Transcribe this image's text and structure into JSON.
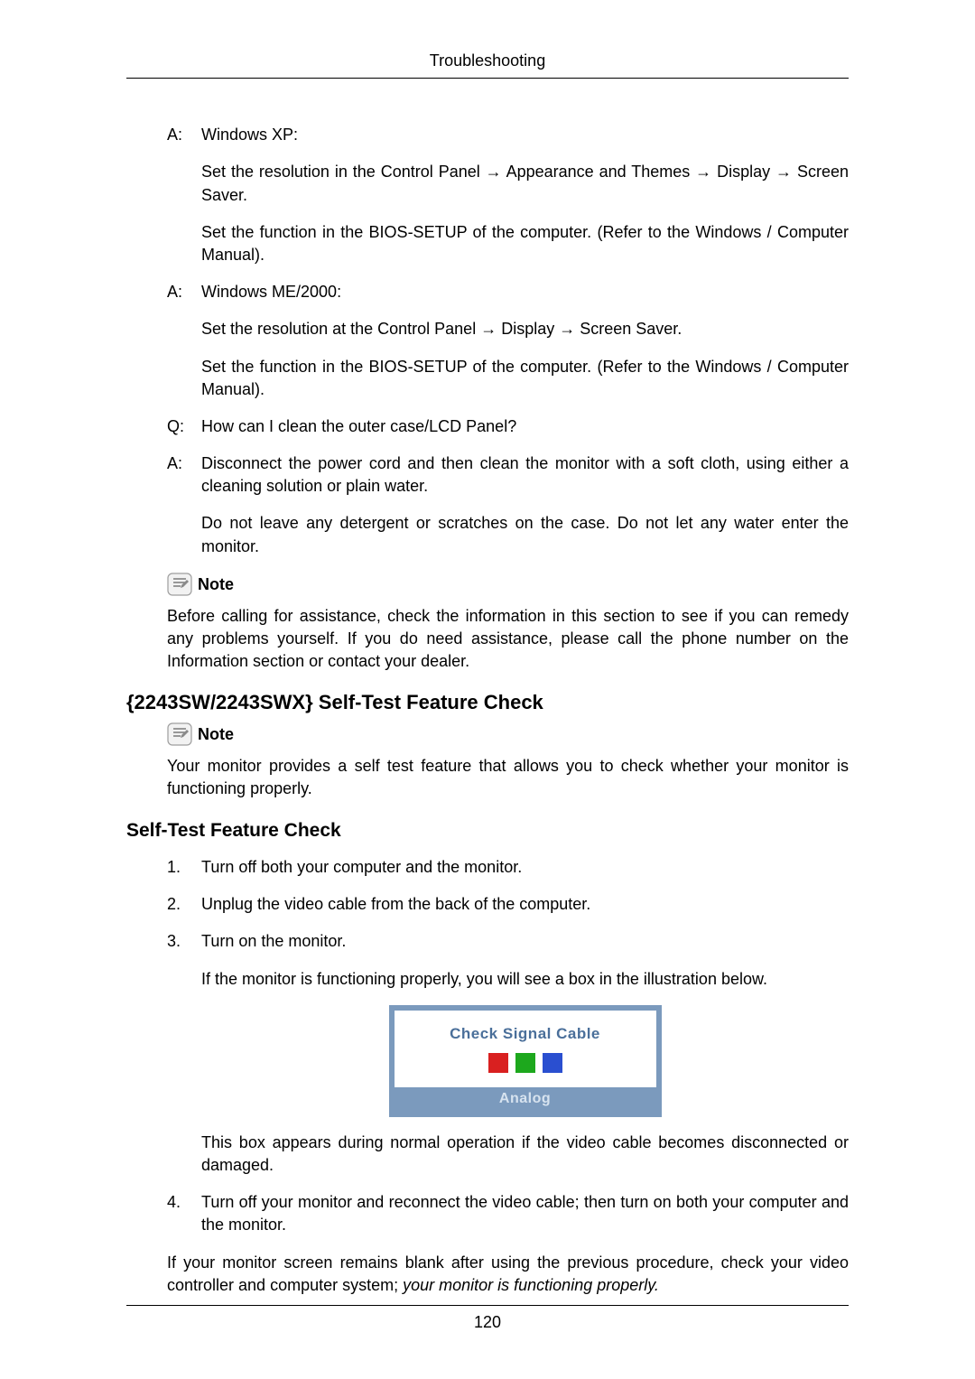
{
  "header": {
    "title": "Troubleshooting"
  },
  "qa": [
    {
      "marker": "A:",
      "paras": [
        "Windows XP:",
        "Set the resolution in the Control Panel → Appearance and Themes → Display → Screen Saver.",
        "Set the function in the BIOS-SETUP of the computer. (Refer to the Windows / Computer Manual)."
      ]
    },
    {
      "marker": "A:",
      "paras": [
        "Windows ME/2000:",
        "Set the resolution at the Control Panel → Display → Screen Saver.",
        "Set the function in the BIOS-SETUP of the computer. (Refer to the Windows / Computer Manual)."
      ]
    },
    {
      "marker": "Q:",
      "paras": [
        "How can I clean the outer case/LCD Panel?"
      ]
    },
    {
      "marker": "A:",
      "paras": [
        "Disconnect the power cord and then clean the monitor with a soft cloth, using either a cleaning solution or plain water.",
        "Do not leave any detergent or scratches on the case. Do not let any water enter the monitor."
      ]
    }
  ],
  "note1": {
    "label": "Note",
    "text": "Before calling for assistance, check the information in this section to see if you can remedy any problems yourself. If you do need assistance, please call the phone number on the Information section or contact your dealer."
  },
  "h2": "{2243SW/2243SWX} Self-Test Feature Check",
  "note2": {
    "label": "Note",
    "text": "Your monitor provides a self test feature that allows you to check whether your monitor is functioning properly."
  },
  "h3": "Self-Test Feature Check",
  "steps": [
    {
      "num": "1.",
      "paras": [
        "Turn off both your computer and the monitor."
      ]
    },
    {
      "num": "2.",
      "paras": [
        "Unplug the video cable from the back of the computer."
      ]
    },
    {
      "num": "3.",
      "paras": [
        "Turn on the monitor.",
        "If the monitor is functioning properly, you will see a box in the illustration below."
      ],
      "has_image": true,
      "after_paras": [
        "This box appears during normal operation if the video cable becomes disconnected or damaged."
      ]
    },
    {
      "num": "4.",
      "paras": [
        "Turn off your monitor and reconnect the video cable; then turn on both your computer and the monitor."
      ]
    }
  ],
  "screen_image": {
    "line1": "Check Signal Cable",
    "analog": "Analog"
  },
  "closing": {
    "prefix": "If your monitor screen remains blank after using the previous procedure, check your video controller and computer system; ",
    "italic": "your monitor is functioning properly."
  },
  "footer": {
    "page_number": "120"
  }
}
